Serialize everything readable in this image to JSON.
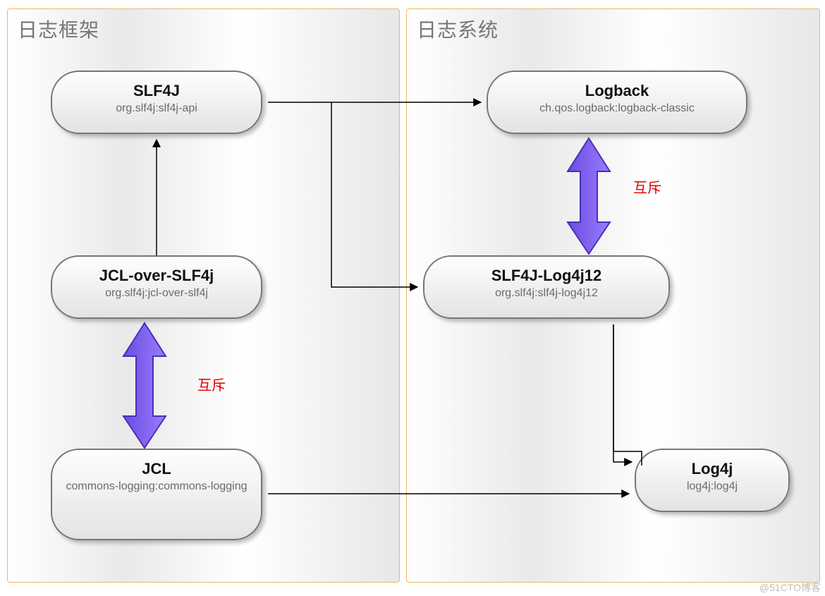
{
  "panels": {
    "left": {
      "title": "日志框架"
    },
    "right": {
      "title": "日志系统"
    }
  },
  "nodes": {
    "slf4j": {
      "title": "SLF4J",
      "sub": "org.slf4j:slf4j-api"
    },
    "jclover": {
      "title": "JCL-over-SLF4j",
      "sub": "org.slf4j:jcl-over-slf4j"
    },
    "jcl": {
      "title": "JCL",
      "sub": "commons-logging:commons-logging"
    },
    "logback": {
      "title": "Logback",
      "sub": "ch.qos.logback:logback-classic"
    },
    "bridge": {
      "title": "SLF4J-Log4j12",
      "sub": "org.slf4j:slf4j-log4j12"
    },
    "log4j": {
      "title": "Log4j",
      "sub": "log4j:log4j"
    }
  },
  "labels": {
    "mutex_left": "互斥",
    "mutex_right": "互斥"
  },
  "watermark": "@51CTO博客"
}
